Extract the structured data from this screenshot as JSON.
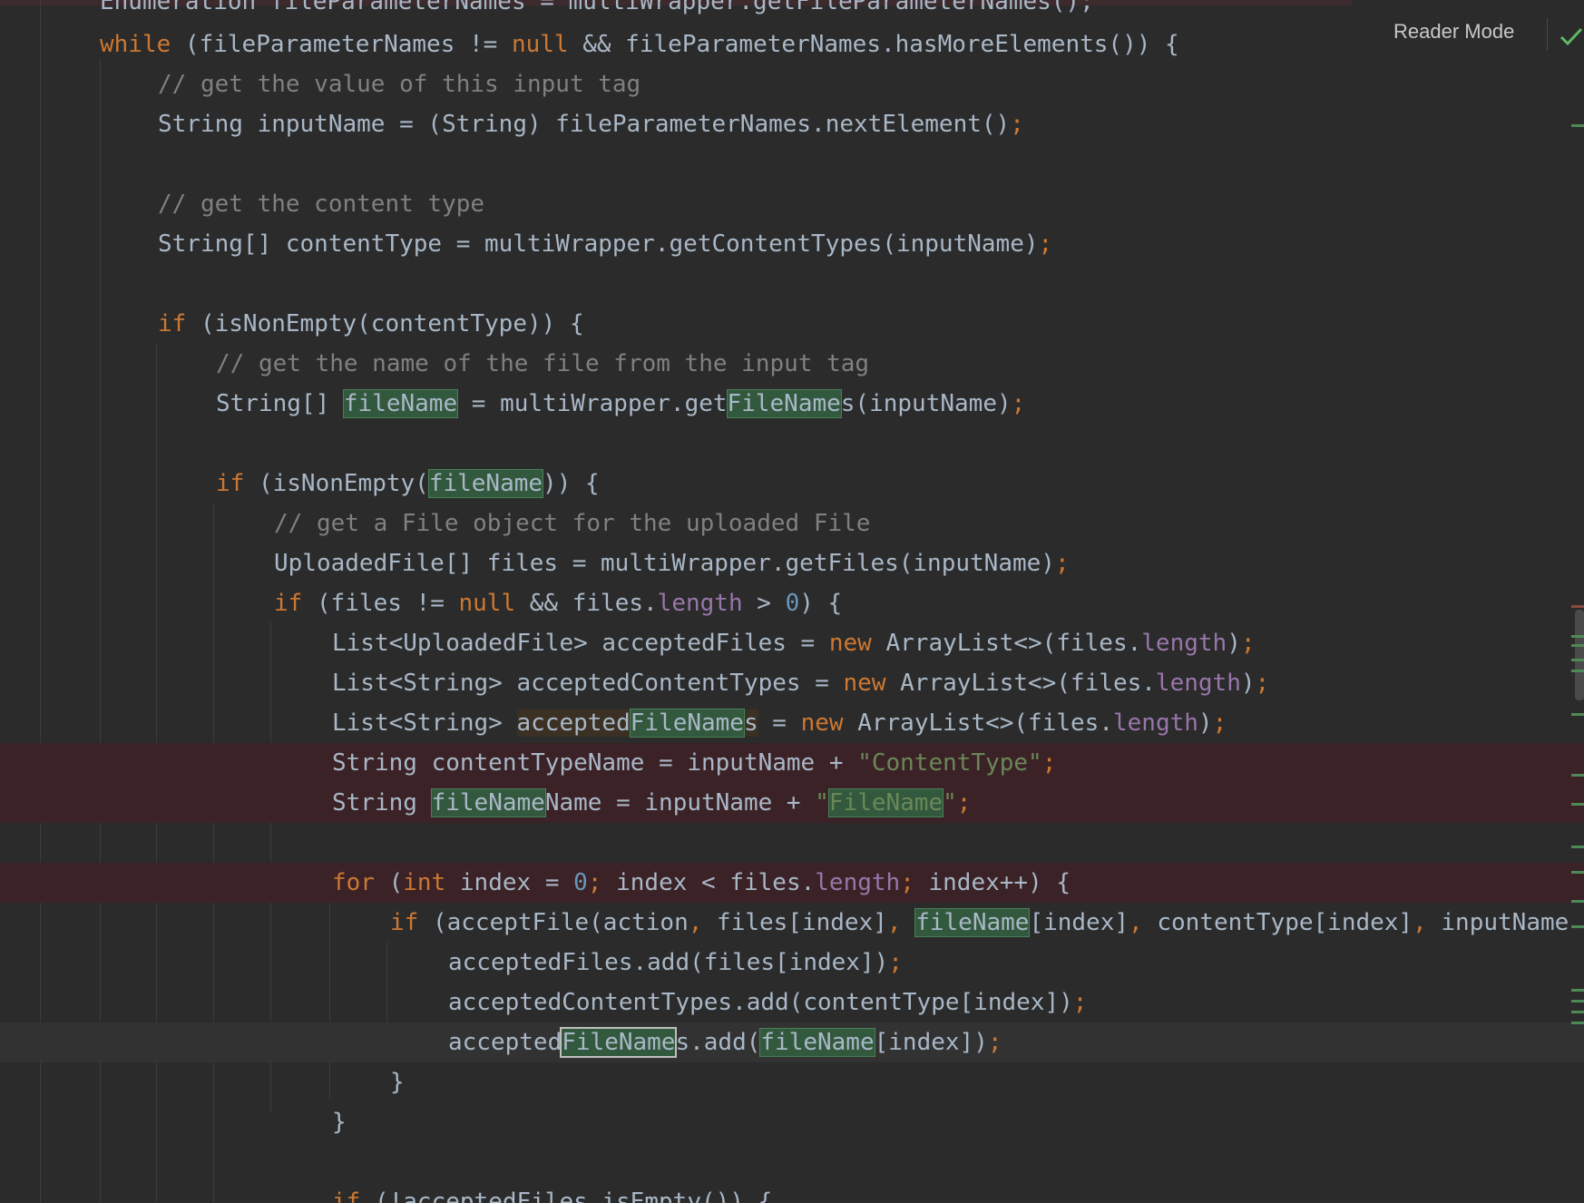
{
  "toolbar": {
    "reader_mode_label": "Reader Mode",
    "status_icon": "check-icon",
    "status_color": "#5fb865"
  },
  "colors": {
    "background": "#2b2b2b",
    "keyword": "#cc7832",
    "comment": "#808080",
    "string": "#6a8759",
    "number": "#6897bb",
    "field": "#9876aa",
    "text": "#a9b7c6",
    "occurrence_highlight": "#32593d",
    "changed_line": "#3b2226"
  },
  "code": {
    "top_partial": "Enumeration fileParameterNames = multiWrapper.getFileParameterNames();",
    "l1": {
      "kw": "while",
      "a": " (fileParameterNames != ",
      "kw2": "null",
      "b": " && fileParameterNames.hasMoreElements()) {"
    },
    "l2": {
      "comment": "// get the value of this input tag"
    },
    "l3": {
      "a": "String inputName = (String) fileParameterNames.nextElement()",
      "semi": ";"
    },
    "l4": {
      "comment": "// get the content type"
    },
    "l5": {
      "a": "String[] contentType = multiWrapper.getContentTypes(inputName)",
      "semi": ";"
    },
    "l6": {
      "kw": "if",
      "a": " (isNonEmpty(contentType)) {"
    },
    "l7": {
      "comment": "// get the name of the file from the input tag"
    },
    "l8": {
      "a": "String[] ",
      "occ1": "fileName",
      "b": " = multiWrapper.get",
      "occ2": "FileName",
      "c": "s(inputName)",
      "semi": ";"
    },
    "l9": {
      "kw": "if",
      "a": " (isNonEmpty(",
      "occ1": "fileName",
      "b": ")) {"
    },
    "l10": {
      "comment": "// get a File object for the uploaded File"
    },
    "l11": {
      "a": "UploadedFile[] files = multiWrapper.getFiles(inputName)",
      "semi": ";"
    },
    "l12": {
      "kw": "if",
      "a": " (files != ",
      "kw2": "null",
      "b": " && files.",
      "fld": "length",
      "c": " > ",
      "num": "0",
      "d": ") {"
    },
    "l13": {
      "a": "List<UploadedFile> acceptedFiles = ",
      "kw": "new",
      "b": " ArrayList<>(files.",
      "fld": "length",
      "c": ")",
      "semi": ";"
    },
    "l14": {
      "a": "List<String> acceptedContentTypes = ",
      "kw": "new",
      "b": " ArrayList<>(files.",
      "fld": "length",
      "c": ")",
      "semi": ";"
    },
    "l15": {
      "a": "List<String> ",
      "p1": "accepted",
      "occ": "FileName",
      "p2": "s",
      "b": " = ",
      "kw": "new",
      "c": " ArrayList<>(files.",
      "fld": "length",
      "d": ")",
      "semi": ";"
    },
    "l16": {
      "a": "String contentTypeName = inputName + ",
      "str": "\"ContentType\"",
      "semi": ";"
    },
    "l17": {
      "a": "String ",
      "occ": "fileName",
      "b": "Name = inputName + ",
      "q1": "\"",
      "occ2": "FileName",
      "q2": "\"",
      "semi": ";"
    },
    "l18": {
      "kw": "for",
      "a": " (",
      "kw2": "int",
      "b": " index = ",
      "num": "0",
      "s1": ";",
      "c": " index < files.",
      "fld": "length",
      "s2": ";",
      "d": " index++) {"
    },
    "l19": {
      "kw": "if",
      "a": " (acceptFile(action",
      "s1": ",",
      "b": " files[index]",
      "s2": ",",
      "sp": " ",
      "occ": "fileName",
      "c": "[index]",
      "s3": ",",
      "d": " contentType[index]",
      "s4": ",",
      "e": " inputName"
    },
    "l20": {
      "a": "acceptedFiles.add(files[index])",
      "semi": ";"
    },
    "l21": {
      "a": "acceptedContentTypes.add(contentType[index])",
      "semi": ";"
    },
    "l22": {
      "a": "accepted",
      "occ": "FileName",
      "b": "s.add(",
      "occ2": "fileName",
      "c": "[index])",
      "semi": ";"
    },
    "l23": {
      "a": "}"
    },
    "l24": {
      "a": "}"
    },
    "l25": {
      "kw": "if",
      "a": " (!acceptedFiles.isEmpty()) {"
    }
  }
}
